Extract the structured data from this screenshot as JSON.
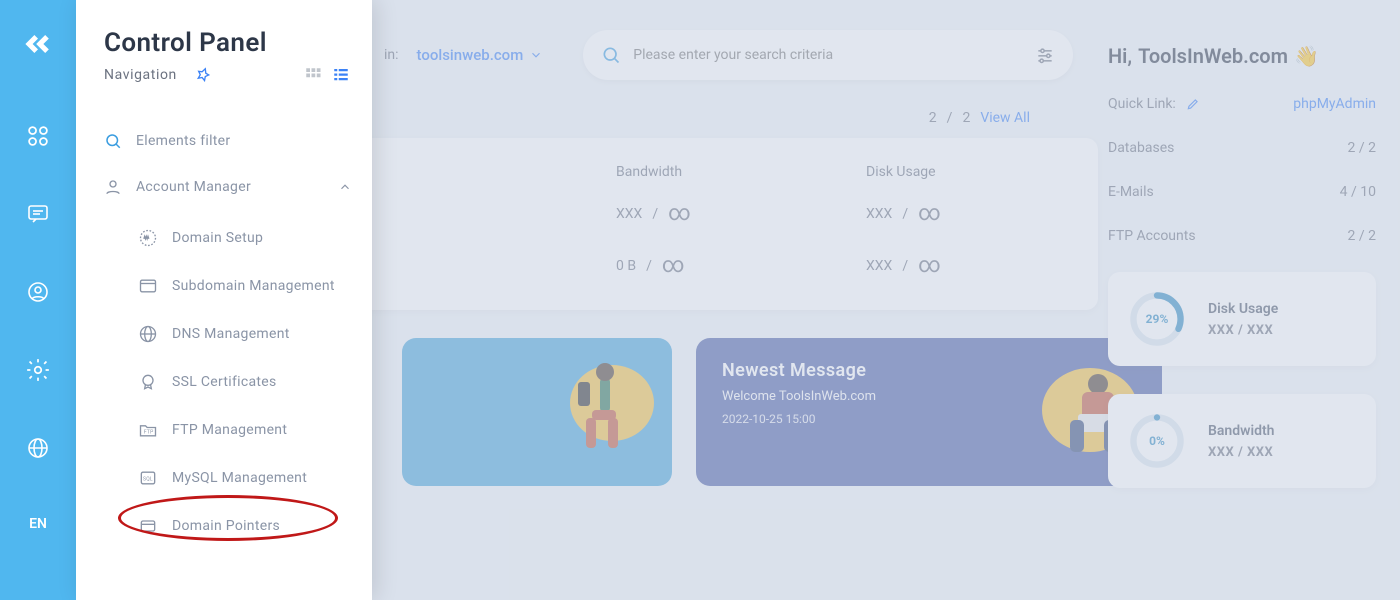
{
  "rail": {
    "lang": "EN"
  },
  "nav": {
    "title": "Control Panel",
    "subtitle": "Navigation",
    "filter_label": "Elements filter",
    "section": "Account Manager",
    "items": [
      "Domain Setup",
      "Subdomain Management",
      "DNS Management",
      "SSL Certificates",
      "FTP Management",
      "MySQL Management",
      "Domain Pointers"
    ]
  },
  "topbar": {
    "in_label": "in:",
    "domain": "toolsinweb.com",
    "search_placeholder": "Please enter your search criteria"
  },
  "pager": {
    "current": "2",
    "sep": "/",
    "total": "2",
    "viewall": "View All"
  },
  "stats": {
    "headers": {
      "bw": "Bandwidth",
      "du": "Disk Usage"
    },
    "rows": [
      {
        "bw": "XXX",
        "du": "XXX"
      },
      {
        "bw": "0 B",
        "du": "XXX"
      }
    ],
    "slash": "/"
  },
  "cards": {
    "newest_title": "Newest Message",
    "newest_welcome": "Welcome ToolsInWeb.com",
    "newest_ts": "2022-10-25 15:00"
  },
  "right": {
    "hello_prefix": "Hi, ",
    "hello_name": "ToolsInWeb.com",
    "quicklink_label": "Quick Link:",
    "quicklink_target": "phpMyAdmin",
    "rows": [
      {
        "k": "Databases",
        "v": "2 / 2"
      },
      {
        "k": "E-Mails",
        "v": "4 / 10"
      },
      {
        "k": "FTP Accounts",
        "v": "2 / 2"
      }
    ],
    "gauges": [
      {
        "pct": "29%",
        "title": "Disk Usage",
        "vals": "XXX  /  XXX",
        "dash": "52 128"
      },
      {
        "pct": "0%",
        "title": "Bandwidth",
        "vals": "XXX  /  XXX",
        "dash": "0 180"
      }
    ]
  }
}
